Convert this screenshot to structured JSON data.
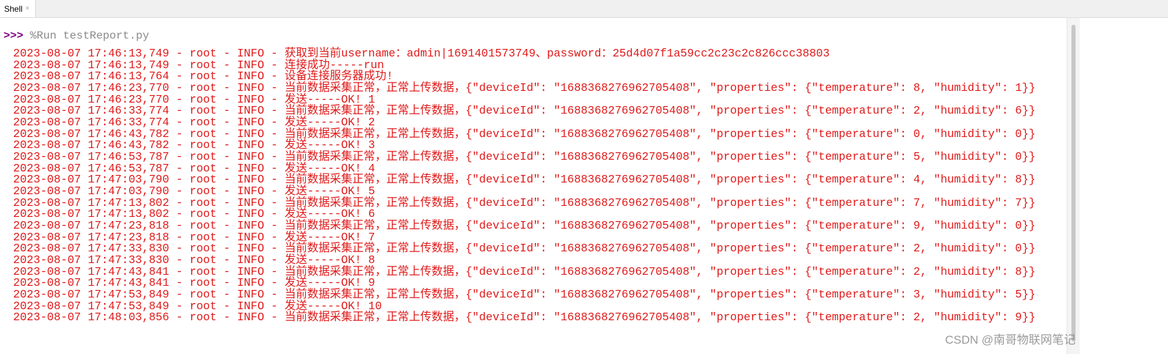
{
  "tab": {
    "label": "Shell",
    "close": "×"
  },
  "prompt": {
    "chevrons": ">>>",
    "command": "%Run testReport.py"
  },
  "lines": [
    "2023-08-07 17:46:13,749 - root - INFO - 获取到当前username：admin|1691401573749、password：25d4d07f1a59cc2c23c2c826ccc38803",
    "2023-08-07 17:46:13,749 - root - INFO - 连接成功-----run",
    "2023-08-07 17:46:13,764 - root - INFO - 设备连接服务器成功!",
    "2023-08-07 17:46:23,770 - root - INFO - 当前数据采集正常，正常上传数据，{\"deviceId\": \"1688368276962705408\", \"properties\": {\"temperature\": 8, \"humidity\": 1}}",
    "2023-08-07 17:46:23,770 - root - INFO - 发送-----OK! 1",
    "2023-08-07 17:46:33,774 - root - INFO - 当前数据采集正常，正常上传数据，{\"deviceId\": \"1688368276962705408\", \"properties\": {\"temperature\": 2, \"humidity\": 6}}",
    "2023-08-07 17:46:33,774 - root - INFO - 发送-----OK! 2",
    "2023-08-07 17:46:43,782 - root - INFO - 当前数据采集正常，正常上传数据，{\"deviceId\": \"1688368276962705408\", \"properties\": {\"temperature\": 0, \"humidity\": 0}}",
    "2023-08-07 17:46:43,782 - root - INFO - 发送-----OK! 3",
    "2023-08-07 17:46:53,787 - root - INFO - 当前数据采集正常，正常上传数据，{\"deviceId\": \"1688368276962705408\", \"properties\": {\"temperature\": 5, \"humidity\": 0}}",
    "2023-08-07 17:46:53,787 - root - INFO - 发送-----OK! 4",
    "2023-08-07 17:47:03,790 - root - INFO - 当前数据采集正常，正常上传数据，{\"deviceId\": \"1688368276962705408\", \"properties\": {\"temperature\": 4, \"humidity\": 8}}",
    "2023-08-07 17:47:03,790 - root - INFO - 发送-----OK! 5",
    "2023-08-07 17:47:13,802 - root - INFO - 当前数据采集正常，正常上传数据，{\"deviceId\": \"1688368276962705408\", \"properties\": {\"temperature\": 7, \"humidity\": 7}}",
    "2023-08-07 17:47:13,802 - root - INFO - 发送-----OK! 6",
    "2023-08-07 17:47:23,818 - root - INFO - 当前数据采集正常，正常上传数据，{\"deviceId\": \"1688368276962705408\", \"properties\": {\"temperature\": 9, \"humidity\": 0}}",
    "2023-08-07 17:47:23,818 - root - INFO - 发送-----OK! 7",
    "2023-08-07 17:47:33,830 - root - INFO - 当前数据采集正常，正常上传数据，{\"deviceId\": \"1688368276962705408\", \"properties\": {\"temperature\": 2, \"humidity\": 0}}",
    "2023-08-07 17:47:33,830 - root - INFO - 发送-----OK! 8",
    "2023-08-07 17:47:43,841 - root - INFO - 当前数据采集正常，正常上传数据，{\"deviceId\": \"1688368276962705408\", \"properties\": {\"temperature\": 2, \"humidity\": 8}}",
    "2023-08-07 17:47:43,841 - root - INFO - 发送-----OK! 9",
    "2023-08-07 17:47:53,849 - root - INFO - 当前数据采集正常，正常上传数据，{\"deviceId\": \"1688368276962705408\", \"properties\": {\"temperature\": 3, \"humidity\": 5}}",
    "2023-08-07 17:47:53,849 - root - INFO - 发送-----OK! 10",
    "2023-08-07 17:48:03,856 - root - INFO - 当前数据采集正常，正常上传数据，{\"deviceId\": \"1688368276962705408\", \"properties\": {\"temperature\": 2, \"humidity\": 9}}"
  ],
  "watermark": "CSDN @南哥物联网笔记"
}
